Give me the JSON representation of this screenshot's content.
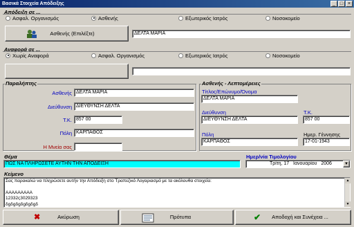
{
  "window": {
    "title": "Βασικά Στοιχεία Απόδειξης",
    "min": "_",
    "max": "□",
    "close": "×"
  },
  "issued_to": {
    "label": "Απόδειξη σε ...",
    "options": [
      "Ασφαλ. Οργανισμός",
      "Ασθενής",
      "Εξωτερικός Ιατρός",
      "Νοσοκομείο"
    ],
    "selected": "Ασθενής",
    "select_button": "Ασθενής (Επιλέξτε)",
    "value": "ΔΕΛΤΑ ΜΑΡΙΑ"
  },
  "reference": {
    "label": "Αναφορά σε ...",
    "options": [
      "Χωρίς Αναφορά",
      "Ασφαλ. Οργανισμός",
      "Εξωτερικός Ιατρός",
      "Νοσοκομείο"
    ],
    "selected": "Χωρίς Αναφορά",
    "value": ""
  },
  "recipient": {
    "header": "Παραλήπτης",
    "name_label": "Ασθενής",
    "name": "ΔΕΛΤΑ ΜΑΡΙΑ",
    "address_label": "Διεύθυνση",
    "address": "ΔΙΕΥΘΥΝΣΗ ΔΕΛΤΑ",
    "zip_label": "Τ.Κ.",
    "zip": "857 00",
    "city_label": "Πόλη",
    "city": "ΚΑΡΠΑΘΟΣ",
    "mention_label": "Η Μνεία σας",
    "mention": ""
  },
  "patient": {
    "header": "Ασθενής - Λεπτομέρειες",
    "title_label": "Τίτλος/Επώνυμο/Όνομα",
    "title": "ΔΕΛΤΑ ΜΑΡΙΑ",
    "address_label": "Διεύθυνση",
    "address": "ΔΙΕΥΘΥΝΣΗ ΔΕΛΤΑ",
    "zip_label": "Τ.Κ.",
    "zip": "857 00",
    "city_label": "Πόλη",
    "city": "ΚΑΡΠΑΘΟΣ",
    "birth_label": "Ημερ. Γέννησης",
    "birth": "17-01-1943"
  },
  "subject": {
    "label": "Θέμα",
    "value": "ΠΩΣ ΝΑ ΠΛΗΡΩΣΕΤΕ ΑΥΤΗΝ ΤΗΝ ΑΠΟΔΕΙΞΗ"
  },
  "invoice_date": {
    "label": "Ημερ/νία Τιμολογίου",
    "day": "Τρίτη",
    "date": ", 17   Ιανουαρίου   2006"
  },
  "body": {
    "label": "Κείμενο",
    "lines": [
      "Σας παρακαλώ να πληρώσετε αυτήν την Απόδειξη στο Τραπεζικό Λογαριασμό με τα ακόλουθα στοιχεία:",
      "",
      "AAAAAAAAA",
      "12332ς3029323",
      "δgδgδgδgδgδgδ"
    ]
  },
  "buttons": {
    "cancel": "Ακύρωση",
    "template": "Πρότυπα",
    "save": "Αποδοχή και Συνέχεια ..."
  },
  "colors": {
    "highlight": "#00ffff",
    "label_blue": "#0000c0",
    "label_red": "#a00000"
  }
}
